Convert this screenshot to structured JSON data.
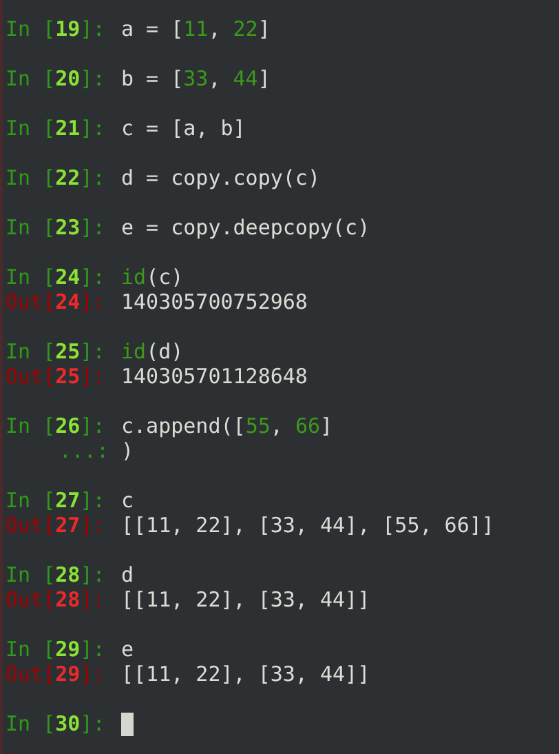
{
  "cells": [
    {
      "lines": [
        {
          "kind": "in",
          "prompt": "In [**19**]:",
          "code": [
            {
              "kind": "plain",
              "text": "a = ["
            },
            {
              "kind": "number",
              "text": "11"
            },
            {
              "kind": "plain",
              "text": ", "
            },
            {
              "kind": "number",
              "text": "22"
            },
            {
              "kind": "plain",
              "text": "]"
            }
          ]
        }
      ]
    },
    {
      "lines": [
        {
          "kind": "in",
          "prompt": "In [**20**]:",
          "code": [
            {
              "kind": "plain",
              "text": "b = ["
            },
            {
              "kind": "number",
              "text": "33"
            },
            {
              "kind": "plain",
              "text": ", "
            },
            {
              "kind": "number",
              "text": "44"
            },
            {
              "kind": "plain",
              "text": "]"
            }
          ]
        }
      ]
    },
    {
      "lines": [
        {
          "kind": "in",
          "prompt": "In [**21**]:",
          "code": [
            {
              "kind": "plain",
              "text": "c = [a, b]"
            }
          ]
        }
      ]
    },
    {
      "lines": [
        {
          "kind": "in",
          "prompt": "In [**22**]:",
          "code": [
            {
              "kind": "plain",
              "text": "d = copy.copy(c)"
            }
          ]
        }
      ]
    },
    {
      "lines": [
        {
          "kind": "in",
          "prompt": "In [**23**]:",
          "code": [
            {
              "kind": "plain",
              "text": "e = copy.deepcopy(c)"
            }
          ]
        }
      ]
    },
    {
      "lines": [
        {
          "kind": "in",
          "prompt": "In [**24**]:",
          "code": [
            {
              "kind": "builtin",
              "text": "id"
            },
            {
              "kind": "plain",
              "text": "(c)"
            }
          ]
        },
        {
          "kind": "out",
          "prompt": "Out[**24**]:",
          "code": [
            {
              "kind": "plain",
              "text": "140305700752968"
            }
          ]
        }
      ]
    },
    {
      "lines": [
        {
          "kind": "in",
          "prompt": "In [**25**]:",
          "code": [
            {
              "kind": "builtin",
              "text": "id"
            },
            {
              "kind": "plain",
              "text": "(d)"
            }
          ]
        },
        {
          "kind": "out",
          "prompt": "Out[**25**]:",
          "code": [
            {
              "kind": "plain",
              "text": "140305701128648"
            }
          ]
        }
      ]
    },
    {
      "lines": [
        {
          "kind": "in",
          "prompt": "In [**26**]:",
          "code": [
            {
              "kind": "plain",
              "text": "c.append(["
            },
            {
              "kind": "number",
              "text": "55"
            },
            {
              "kind": "plain",
              "text": ", "
            },
            {
              "kind": "number",
              "text": "66"
            },
            {
              "kind": "plain",
              "text": "]"
            }
          ]
        },
        {
          "kind": "continuation",
          "prompt": "...:",
          "code": [
            {
              "kind": "plain",
              "text": ")"
            }
          ]
        }
      ]
    },
    {
      "lines": [
        {
          "kind": "in",
          "prompt": "In [**27**]:",
          "code": [
            {
              "kind": "plain",
              "text": "c"
            }
          ]
        },
        {
          "kind": "out",
          "prompt": "Out[**27**]:",
          "code": [
            {
              "kind": "plain",
              "text": "[[11, 22], [33, 44], [55, 66]]"
            }
          ]
        }
      ]
    },
    {
      "lines": [
        {
          "kind": "in",
          "prompt": "In [**28**]:",
          "code": [
            {
              "kind": "plain",
              "text": "d"
            }
          ]
        },
        {
          "kind": "out",
          "prompt": "Out[**28**]:",
          "code": [
            {
              "kind": "plain",
              "text": "[[11, 22], [33, 44]]"
            }
          ]
        }
      ]
    },
    {
      "lines": [
        {
          "kind": "in",
          "prompt": "In [**29**]:",
          "code": [
            {
              "kind": "plain",
              "text": "e"
            }
          ]
        },
        {
          "kind": "out",
          "prompt": "Out[**29**]:",
          "code": [
            {
              "kind": "plain",
              "text": "[[11, 22], [33, 44]]"
            }
          ]
        }
      ]
    },
    {
      "lines": [
        {
          "kind": "in",
          "prompt": "In [**30**]:",
          "cursor": true
        }
      ]
    }
  ]
}
